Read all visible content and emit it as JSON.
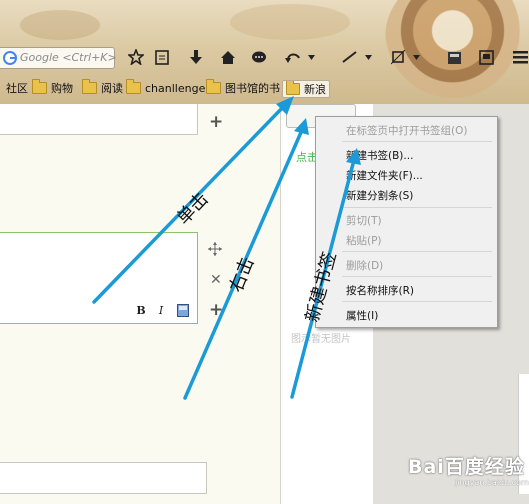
{
  "toolbar": {
    "search_placeholder": "Google <Ctrl+K>"
  },
  "bookmarks_bar": {
    "items": [
      {
        "label": "社区",
        "folder": false
      },
      {
        "label": "购物",
        "folder": true
      },
      {
        "label": "阅读",
        "folder": true
      },
      {
        "label": "chanllenge",
        "folder": true
      },
      {
        "label": "图书馆的书",
        "folder": true
      },
      {
        "label": "新浪",
        "folder": true
      }
    ]
  },
  "page": {
    "green_link": "点击",
    "no_image_text": "图示暂无图片",
    "format_buttons": [
      "B",
      "I"
    ]
  },
  "context_menu": {
    "items": [
      {
        "label": "在标签页中打开书签组(O)",
        "enabled": false
      },
      {
        "label": "新建书签(B)...",
        "enabled": true
      },
      {
        "label": "新建文件夹(F)...",
        "enabled": true
      },
      {
        "label": "新建分割条(S)",
        "enabled": true
      },
      {
        "label": "剪切(T)",
        "enabled": false
      },
      {
        "label": "粘贴(P)",
        "enabled": false
      },
      {
        "label": "删除(D)",
        "enabled": false
      },
      {
        "label": "按名称排序(R)",
        "enabled": true
      },
      {
        "label": "属性(I)",
        "enabled": true
      }
    ]
  },
  "annotations": {
    "single_click": "单击",
    "right_click": "右击",
    "new_bookmark": "新建书签",
    "arrow_color": "#1a9ad6"
  },
  "watermark": {
    "brand": "Bai百度经验",
    "url": "jingyan.baidu.com"
  }
}
